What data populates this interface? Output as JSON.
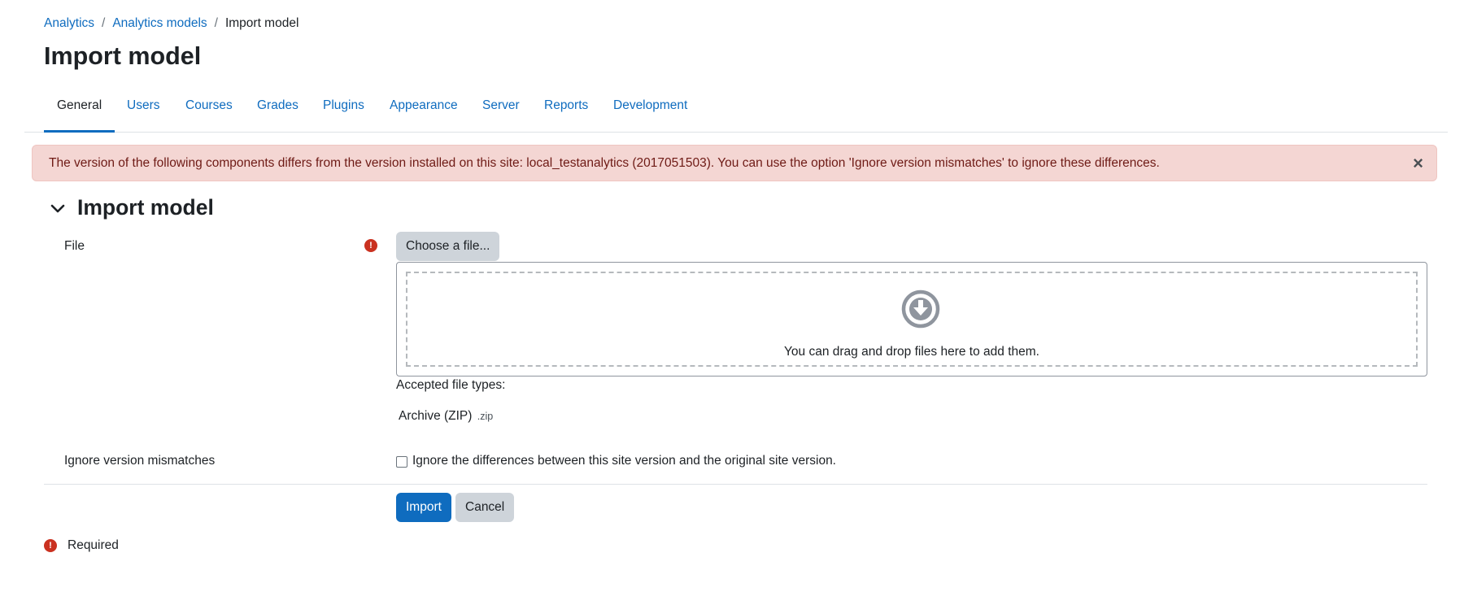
{
  "breadcrumb": {
    "items": [
      "Analytics",
      "Analytics models"
    ],
    "separator": "/",
    "current": "Import model"
  },
  "page_title": "Import model",
  "tabs": [
    "General",
    "Users",
    "Courses",
    "Grades",
    "Plugins",
    "Appearance",
    "Server",
    "Reports",
    "Development"
  ],
  "active_tab": "General",
  "alert": {
    "message": "The version of the following components differs from the version installed on this site: local_testanalytics (2017051503). You can use the option 'Ignore version mismatches' to ignore these differences.",
    "close_icon": "×"
  },
  "section": {
    "title": "Import model",
    "icon": "chevron-down-icon"
  },
  "form": {
    "file_label": "File",
    "required_icon": "!",
    "choose_button": "Choose a file...",
    "drop_text": "You can drag and drop files here to add them.",
    "drop_icon": "arrow-circle-down-icon",
    "accepted_label": "Accepted file types:",
    "accepted_type": "Archive (ZIP)",
    "accepted_ext": ".zip",
    "ignore_label": "Ignore version mismatches",
    "ignore_checkbox_label": "Ignore the differences between this site version and the original site version.",
    "ignore_checked": false,
    "import_button": "Import",
    "cancel_button": "Cancel",
    "required_note": "Required"
  },
  "colors": {
    "primary": "#0f6cbf",
    "alert_bg": "#f4d6d3",
    "required": "#ca3120"
  }
}
